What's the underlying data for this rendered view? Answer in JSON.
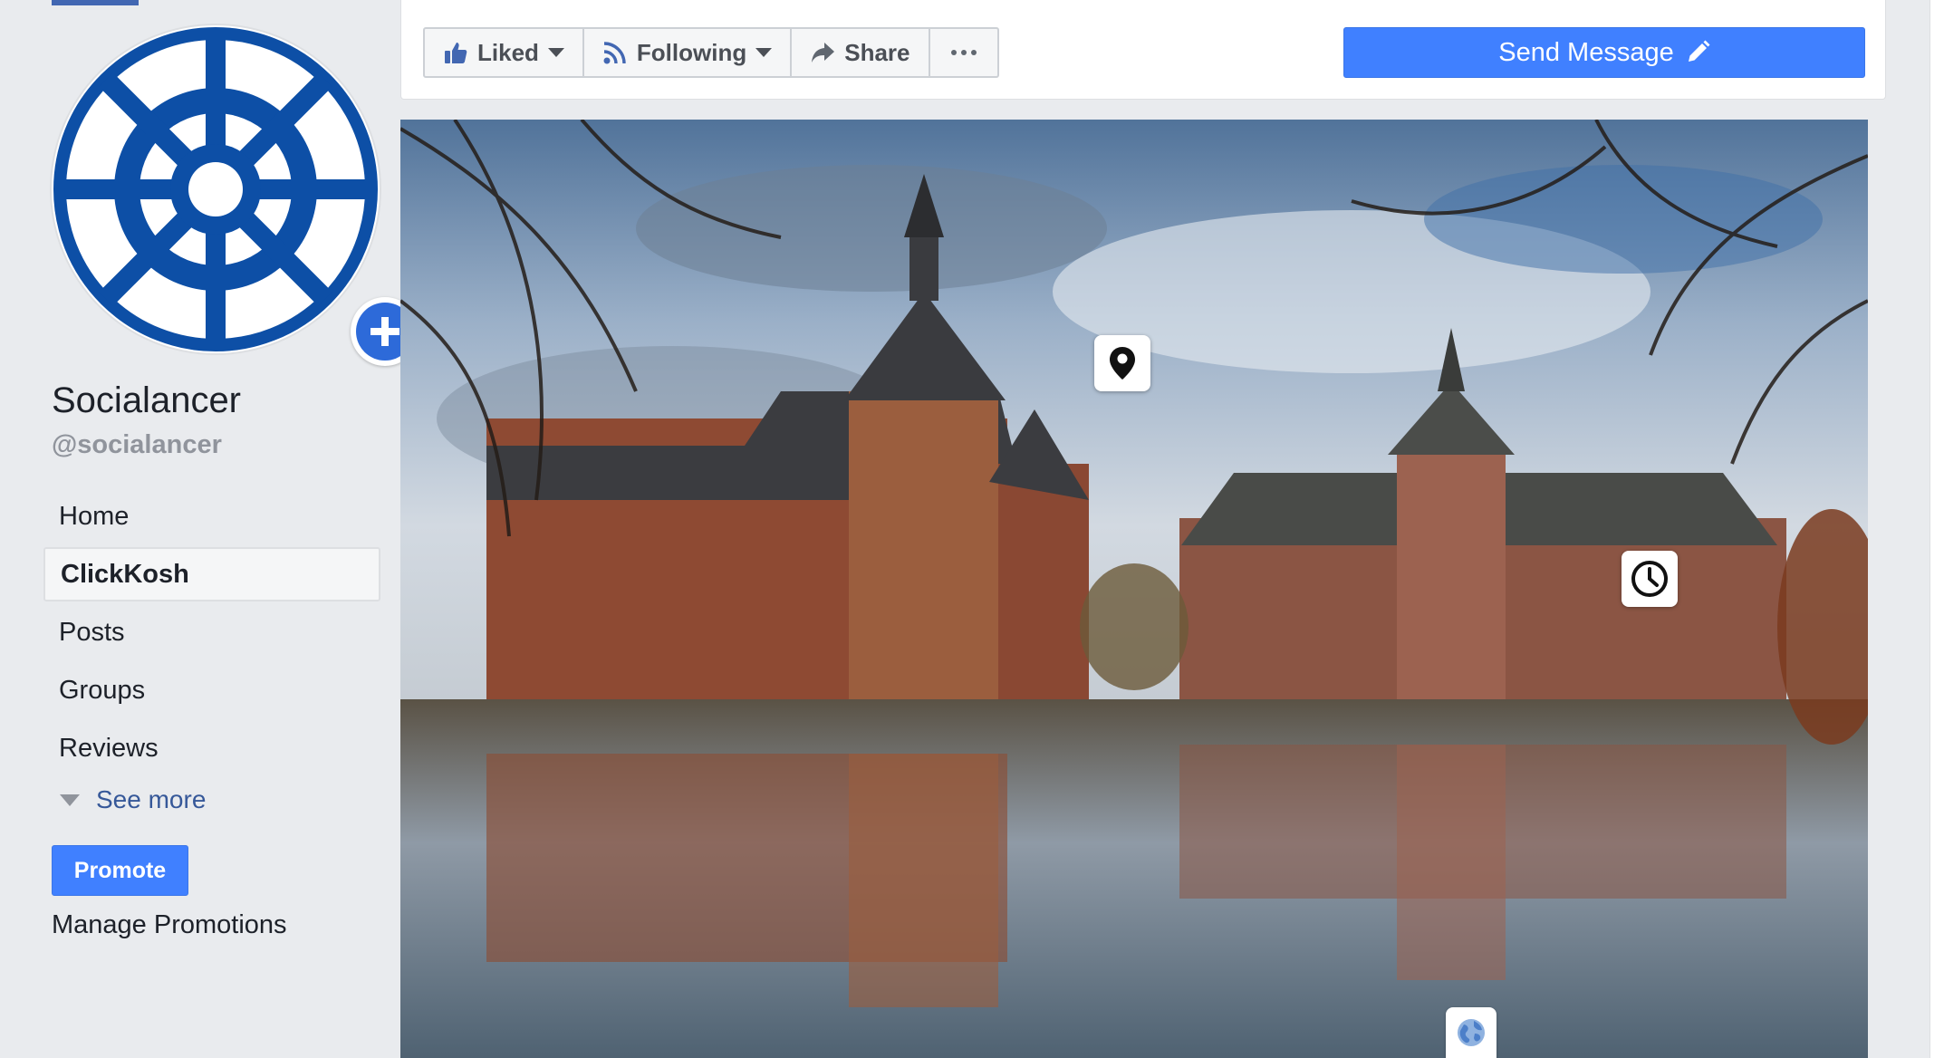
{
  "page": {
    "name": "Socialancer",
    "handle": "@socialancer"
  },
  "avatar": {
    "logo_icon": "ship-wheel-icon",
    "add_icon": "plus-circle-icon",
    "brand_color": "#0d4fa6"
  },
  "nav": {
    "items": [
      {
        "label": "Home",
        "active": false
      },
      {
        "label": "ClickKosh",
        "active": true
      },
      {
        "label": "Posts",
        "active": false
      },
      {
        "label": "Groups",
        "active": false
      },
      {
        "label": "Reviews",
        "active": false
      }
    ],
    "see_more": "See more"
  },
  "promote": {
    "button_label": "Promote",
    "manage_label": "Manage Promotions"
  },
  "actions": {
    "liked": "Liked",
    "following": "Following",
    "share": "Share",
    "more_icon": "ellipsis-icon",
    "send_message": "Send Message",
    "send_message_icon": "pencil-icon"
  },
  "cover": {
    "location_icon": "map-pin-icon",
    "hours_icon": "clock-icon",
    "globe_icon": "globe-icon"
  },
  "colors": {
    "accent": "#4080ff",
    "link": "#365899",
    "background": "#e9ebee"
  }
}
